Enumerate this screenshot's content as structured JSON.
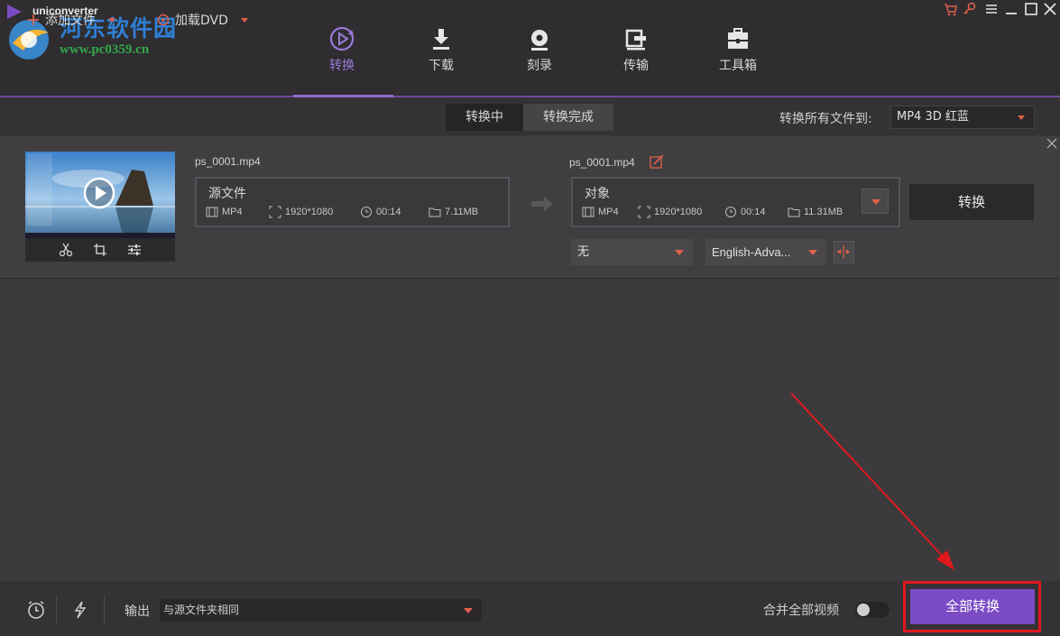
{
  "app": {
    "title": "uniconverter",
    "watermark_name": "河东软件园",
    "watermark_url": "www.pc0359.cn"
  },
  "nav": [
    {
      "label": "转换",
      "icon": "convert-icon",
      "active": true
    },
    {
      "label": "下载",
      "icon": "download-icon",
      "active": false
    },
    {
      "label": "刻录",
      "icon": "burn-disc-icon",
      "active": false
    },
    {
      "label": "传输",
      "icon": "transfer-icon",
      "active": false
    },
    {
      "label": "工具箱",
      "icon": "toolbox-icon",
      "active": false
    }
  ],
  "toolbar": {
    "add_files": "添加文件",
    "load_dvd": "加载DVD",
    "tab_converting": "转换中",
    "tab_finished": "转换完成",
    "convert_all_to_label": "转换所有文件到:",
    "format_value": "MP4 3D 红蓝"
  },
  "file": {
    "source_name": "ps_0001.mp4",
    "target_name": "ps_0001.mp4",
    "source": {
      "title": "源文件",
      "format": "MP4",
      "resolution": "1920*1080",
      "duration": "00:14",
      "size": "7.11MB"
    },
    "target": {
      "title": "对象",
      "format": "MP4",
      "resolution": "1920*1080",
      "duration": "00:14",
      "size": "11.31MB"
    },
    "convert_button": "转换",
    "subtitle_value": "无",
    "audio_value": "English-Adva..."
  },
  "bottom": {
    "output_label": "输出",
    "output_value": "与源文件夹相同",
    "merge_label": "合并全部视频",
    "merge_enabled": false,
    "convert_all_button": "全部转换"
  },
  "colors": {
    "accent": "#7b4bc4",
    "caret": "#e0604a",
    "annotation": "#e0181d"
  }
}
